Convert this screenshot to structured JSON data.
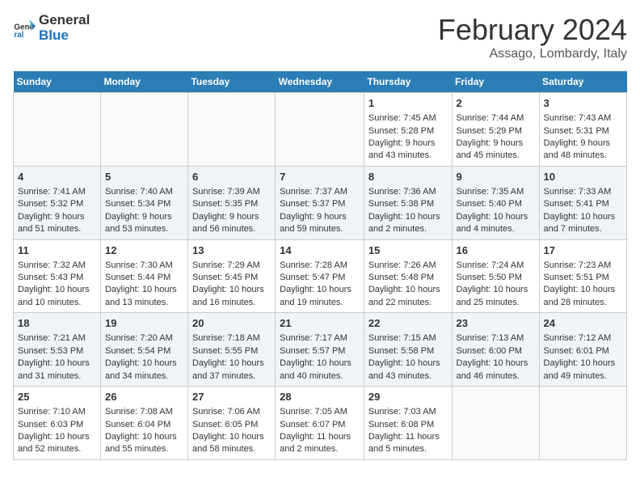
{
  "header": {
    "logo_general": "General",
    "logo_blue": "Blue",
    "title": "February 2024",
    "subtitle": "Assago, Lombardy, Italy"
  },
  "days_of_week": [
    "Sunday",
    "Monday",
    "Tuesday",
    "Wednesday",
    "Thursday",
    "Friday",
    "Saturday"
  ],
  "weeks": [
    [
      {
        "day": "",
        "info": ""
      },
      {
        "day": "",
        "info": ""
      },
      {
        "day": "",
        "info": ""
      },
      {
        "day": "",
        "info": ""
      },
      {
        "day": "1",
        "info": "Sunrise: 7:45 AM\nSunset: 5:28 PM\nDaylight: 9 hours\nand 43 minutes."
      },
      {
        "day": "2",
        "info": "Sunrise: 7:44 AM\nSunset: 5:29 PM\nDaylight: 9 hours\nand 45 minutes."
      },
      {
        "day": "3",
        "info": "Sunrise: 7:43 AM\nSunset: 5:31 PM\nDaylight: 9 hours\nand 48 minutes."
      }
    ],
    [
      {
        "day": "4",
        "info": "Sunrise: 7:41 AM\nSunset: 5:32 PM\nDaylight: 9 hours\nand 51 minutes."
      },
      {
        "day": "5",
        "info": "Sunrise: 7:40 AM\nSunset: 5:34 PM\nDaylight: 9 hours\nand 53 minutes."
      },
      {
        "day": "6",
        "info": "Sunrise: 7:39 AM\nSunset: 5:35 PM\nDaylight: 9 hours\nand 56 minutes."
      },
      {
        "day": "7",
        "info": "Sunrise: 7:37 AM\nSunset: 5:37 PM\nDaylight: 9 hours\nand 59 minutes."
      },
      {
        "day": "8",
        "info": "Sunrise: 7:36 AM\nSunset: 5:38 PM\nDaylight: 10 hours\nand 2 minutes."
      },
      {
        "day": "9",
        "info": "Sunrise: 7:35 AM\nSunset: 5:40 PM\nDaylight: 10 hours\nand 4 minutes."
      },
      {
        "day": "10",
        "info": "Sunrise: 7:33 AM\nSunset: 5:41 PM\nDaylight: 10 hours\nand 7 minutes."
      }
    ],
    [
      {
        "day": "11",
        "info": "Sunrise: 7:32 AM\nSunset: 5:43 PM\nDaylight: 10 hours\nand 10 minutes."
      },
      {
        "day": "12",
        "info": "Sunrise: 7:30 AM\nSunset: 5:44 PM\nDaylight: 10 hours\nand 13 minutes."
      },
      {
        "day": "13",
        "info": "Sunrise: 7:29 AM\nSunset: 5:45 PM\nDaylight: 10 hours\nand 16 minutes."
      },
      {
        "day": "14",
        "info": "Sunrise: 7:28 AM\nSunset: 5:47 PM\nDaylight: 10 hours\nand 19 minutes."
      },
      {
        "day": "15",
        "info": "Sunrise: 7:26 AM\nSunset: 5:48 PM\nDaylight: 10 hours\nand 22 minutes."
      },
      {
        "day": "16",
        "info": "Sunrise: 7:24 AM\nSunset: 5:50 PM\nDaylight: 10 hours\nand 25 minutes."
      },
      {
        "day": "17",
        "info": "Sunrise: 7:23 AM\nSunset: 5:51 PM\nDaylight: 10 hours\nand 28 minutes."
      }
    ],
    [
      {
        "day": "18",
        "info": "Sunrise: 7:21 AM\nSunset: 5:53 PM\nDaylight: 10 hours\nand 31 minutes."
      },
      {
        "day": "19",
        "info": "Sunrise: 7:20 AM\nSunset: 5:54 PM\nDaylight: 10 hours\nand 34 minutes."
      },
      {
        "day": "20",
        "info": "Sunrise: 7:18 AM\nSunset: 5:55 PM\nDaylight: 10 hours\nand 37 minutes."
      },
      {
        "day": "21",
        "info": "Sunrise: 7:17 AM\nSunset: 5:57 PM\nDaylight: 10 hours\nand 40 minutes."
      },
      {
        "day": "22",
        "info": "Sunrise: 7:15 AM\nSunset: 5:58 PM\nDaylight: 10 hours\nand 43 minutes."
      },
      {
        "day": "23",
        "info": "Sunrise: 7:13 AM\nSunset: 6:00 PM\nDaylight: 10 hours\nand 46 minutes."
      },
      {
        "day": "24",
        "info": "Sunrise: 7:12 AM\nSunset: 6:01 PM\nDaylight: 10 hours\nand 49 minutes."
      }
    ],
    [
      {
        "day": "25",
        "info": "Sunrise: 7:10 AM\nSunset: 6:03 PM\nDaylight: 10 hours\nand 52 minutes."
      },
      {
        "day": "26",
        "info": "Sunrise: 7:08 AM\nSunset: 6:04 PM\nDaylight: 10 hours\nand 55 minutes."
      },
      {
        "day": "27",
        "info": "Sunrise: 7:06 AM\nSunset: 6:05 PM\nDaylight: 10 hours\nand 58 minutes."
      },
      {
        "day": "28",
        "info": "Sunrise: 7:05 AM\nSunset: 6:07 PM\nDaylight: 11 hours\nand 2 minutes."
      },
      {
        "day": "29",
        "info": "Sunrise: 7:03 AM\nSunset: 6:08 PM\nDaylight: 11 hours\nand 5 minutes."
      },
      {
        "day": "",
        "info": ""
      },
      {
        "day": "",
        "info": ""
      }
    ]
  ]
}
